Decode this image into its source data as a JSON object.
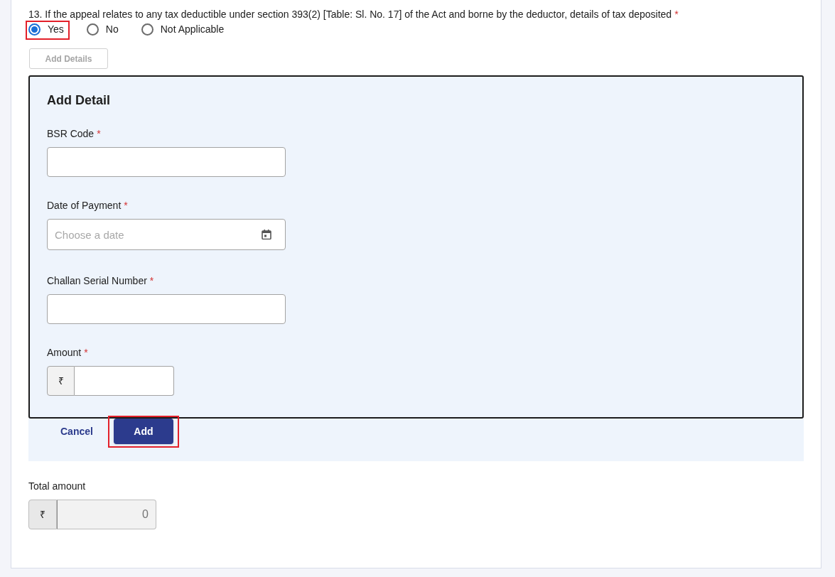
{
  "question": {
    "text": "13. If the appeal relates to any tax deductible under section 393(2) [Table: Sl. No. 17] of the Act and borne by the deductor, details of tax deposited",
    "required_mark": "*",
    "options": [
      {
        "label": "Yes",
        "selected": true,
        "highlighted": true
      },
      {
        "label": "No",
        "selected": false,
        "highlighted": false
      },
      {
        "label": "Not Applicable",
        "selected": false,
        "highlighted": false
      }
    ]
  },
  "add_details_button": {
    "label": "Add Details",
    "disabled": true
  },
  "add_detail_panel": {
    "title": "Add Detail",
    "fields": [
      {
        "kind": "text",
        "label": "BSR Code",
        "required_mark": "*"
      },
      {
        "kind": "date",
        "label": "Date of Payment",
        "required_mark": "*",
        "placeholder": "Choose a date"
      },
      {
        "kind": "text",
        "label": "Challan Serial Number",
        "required_mark": "*"
      },
      {
        "kind": "currency",
        "label": "Amount",
        "required_mark": "*",
        "prefix": "₹"
      }
    ],
    "buttons": [
      {
        "kind": "link",
        "label": "Cancel",
        "highlighted": false
      },
      {
        "kind": "primary",
        "label": "Add",
        "highlighted": true
      }
    ]
  },
  "total_amount": {
    "label": "Total amount",
    "prefix": "₹",
    "value": "0",
    "disabled": true
  }
}
